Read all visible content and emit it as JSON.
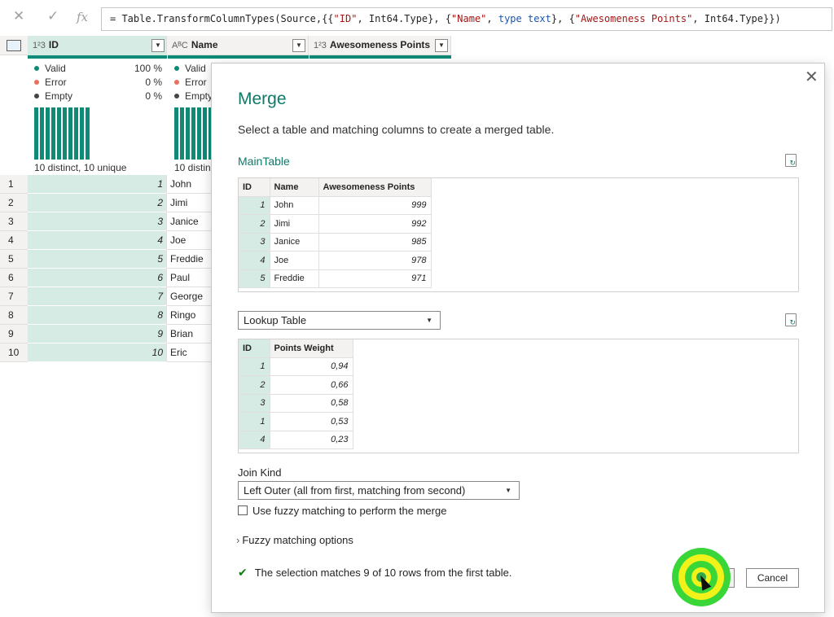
{
  "formula_bar": {
    "cancel_icon": "close-icon",
    "commit_icon": "check-icon",
    "fx_label": "fx",
    "formula_prefix": "= Table.TransformColumnTypes(Source,{{",
    "f_id": "\"ID\"",
    "f_c1": ", Int64.Type}, {",
    "f_name": "\"Name\"",
    "f_c2": ", ",
    "f_type": "type text",
    "f_c3": "}, {",
    "f_awe": "\"Awesomeness Points\"",
    "f_c4": ", Int64.Type}})"
  },
  "grid": {
    "columns": [
      {
        "type_icon": "1²3",
        "name": "ID"
      },
      {
        "type_icon": "AᴮC",
        "name": "Name"
      },
      {
        "type_icon": "1²3",
        "name": "Awesomeness Points"
      }
    ],
    "profile": {
      "valid_label": "Valid",
      "valid_pct": "100 %",
      "error_label": "Error",
      "error_pct": "0 %",
      "empty_label": "Empty",
      "empty_pct": "0 %",
      "distinct_text": "10 distinct, 10 unique",
      "name_distinct_text": "10 distin"
    },
    "row_numbers": [
      "1",
      "2",
      "3",
      "4",
      "5",
      "6",
      "7",
      "8",
      "9",
      "10"
    ],
    "ids": [
      "1",
      "2",
      "3",
      "4",
      "5",
      "6",
      "7",
      "8",
      "9",
      "10"
    ],
    "names": [
      "John",
      "Jimi",
      "Janice",
      "Joe",
      "Freddie",
      "Paul",
      "George",
      "Ringo",
      "Brian",
      "Eric"
    ]
  },
  "dialog": {
    "title": "Merge",
    "subtitle": "Select a table and matching columns to create a merged table.",
    "first_table_name": "MainTable",
    "first_table": {
      "headers": [
        "ID",
        "Name",
        "Awesomeness Points"
      ],
      "rows": [
        [
          "1",
          "John",
          "999"
        ],
        [
          "2",
          "Jimi",
          "992"
        ],
        [
          "3",
          "Janice",
          "985"
        ],
        [
          "4",
          "Joe",
          "978"
        ],
        [
          "5",
          "Freddie",
          "971"
        ]
      ]
    },
    "second_table_select": "Lookup Table",
    "second_table": {
      "headers": [
        "ID",
        "Points Weight"
      ],
      "rows": [
        [
          "1",
          "0,94"
        ],
        [
          "2",
          "0,66"
        ],
        [
          "3",
          "0,58"
        ],
        [
          "1",
          "0,53"
        ],
        [
          "4",
          "0,23"
        ]
      ]
    },
    "join_kind_label": "Join Kind",
    "join_kind_value": "Left Outer (all from first, matching from second)",
    "fuzzy_checkbox_label": "Use fuzzy matching to perform the merge",
    "fuzzy_options_label": "Fuzzy matching options",
    "status_text": "The selection matches 9 of 10 rows from the first table.",
    "ok_label": "OK",
    "cancel_label": "Cancel"
  },
  "colors": {
    "accent": "#0e8a76",
    "selected_column": "#d6ebe3",
    "title": "#0e7a68",
    "click_ring_outer": "#39d63a",
    "click_ring_inner": "#f2f21b"
  }
}
